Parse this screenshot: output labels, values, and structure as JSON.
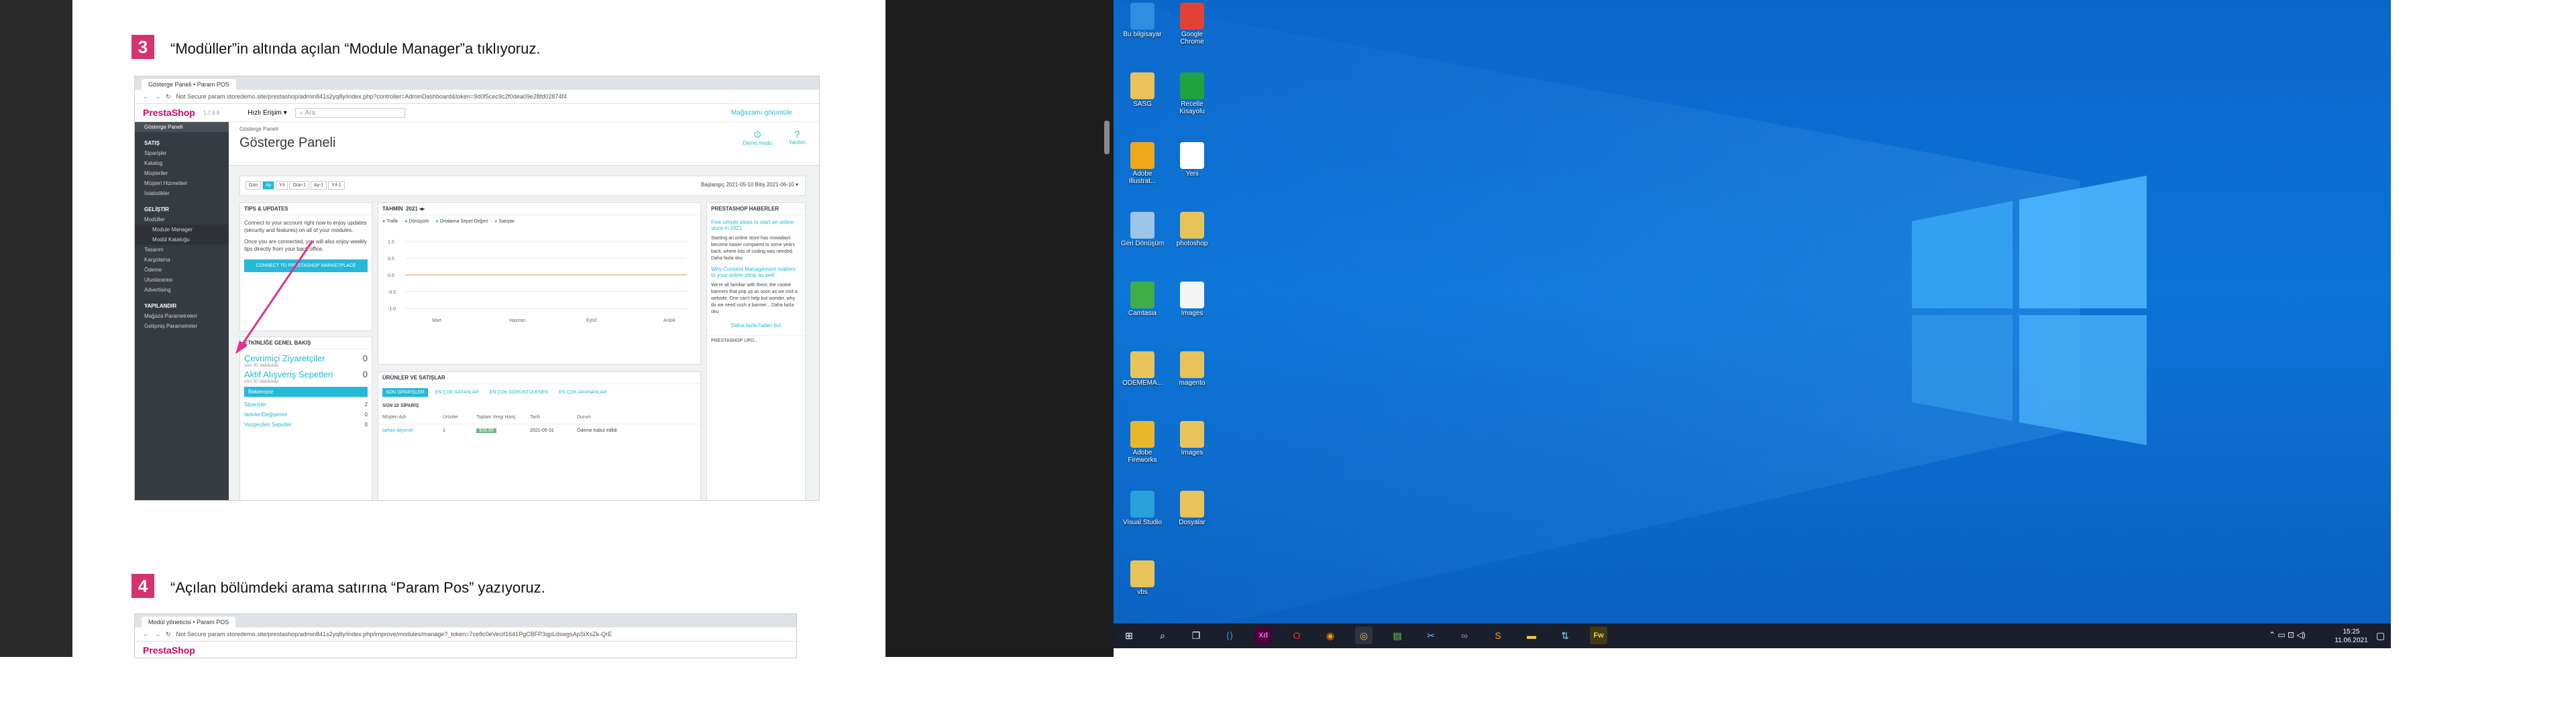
{
  "document": {
    "step3": {
      "number": "3",
      "text": "“Modüller”in altında açılan “Module Manager”a tıklıyoruz."
    },
    "step4": {
      "number": "4",
      "text": "“Açılan bölümdeki arama satırına “Param Pos” yazıyoruz."
    }
  },
  "screenshot1": {
    "tab": "Gösterge Paneli • Param POS",
    "url": "Not Secure   param.storedemo.site/prestashop/admin841s2yq8y/index.php?controller=AdminDashboard&token=9d0f5cec9c2f0dea09e28fd02874f4",
    "logo": "PrestaShop",
    "version": "1.7.6.8",
    "quick": "Hızlı Erişim ▾",
    "search": "Ara",
    "shop_link": "Mağazamı görüntüle",
    "breadcrumb": "Gösterge Paneli",
    "title": "Gösterge Paneli",
    "demo": "Demo modu",
    "help": "Yardım",
    "sidebar": [
      {
        "label": "Gösterge Paneli",
        "type": "item"
      },
      {
        "label": "SATIŞ",
        "type": "sec"
      },
      {
        "label": "Siparişler",
        "type": "item"
      },
      {
        "label": "Katalog",
        "type": "item"
      },
      {
        "label": "Müşteriler",
        "type": "item"
      },
      {
        "label": "Müşteri Hizmetleri",
        "type": "item"
      },
      {
        "label": "İstatistikler",
        "type": "item"
      },
      {
        "label": "GELİŞTİR",
        "type": "sec"
      },
      {
        "label": "Modüller",
        "type": "item"
      },
      {
        "label": "Module Manager",
        "type": "sub"
      },
      {
        "label": "Modül Kataloğu",
        "type": "sub"
      },
      {
        "label": "Tasarım",
        "type": "item"
      },
      {
        "label": "Kargolama",
        "type": "item"
      },
      {
        "label": "Ödeme",
        "type": "item"
      },
      {
        "label": "Uluslararası",
        "type": "item"
      },
      {
        "label": "Advertising",
        "type": "item"
      },
      {
        "label": "YAPILANDIR",
        "type": "sec"
      },
      {
        "label": "Mağaza Parametreleri",
        "type": "item"
      },
      {
        "label": "Gelişmiş Parametreler",
        "type": "item"
      }
    ],
    "range_buttons": [
      "Gün",
      "Ay",
      "Yıl",
      "Gün-1",
      "Ay-1",
      "Yıl-1"
    ],
    "date_range": "Başlangıç 2021-05-10 Bitiş 2021-06-10 ▾",
    "tips_title": "TIPS & UPDATES",
    "tips_text": "Connect to your account right now to enjoy updates (security and features) on all of your modules.",
    "tips_text2": "Once you are connected, you will also enjoy weekly tips directly from your back office.",
    "connect_btn": "CONNECT TO PRESTASHOP MARKETPLACE",
    "activity_title": "ETKİNLİĞE GENEL BAKIŞ",
    "online_visitors": "Çevrimiçi Ziyaretçiler",
    "online_visitors_value": "0",
    "active_carts": "Aktif Alışveriş Sepetleri",
    "active_carts_value": "0",
    "last30": "son 30 dakikada",
    "pending": "Bekleniyor",
    "orders": "Siparişler",
    "orders_value": "2",
    "returns": "İadeler/Değişimler",
    "returns_value": "0",
    "abandoned": "Vazgeçilen Sepetler",
    "abandoned_value": "0",
    "dash_title": "TAHMİN",
    "dash_year": "2021",
    "legend": [
      "Trafik",
      "Dönüşüm",
      "Ortalama Sepet Değeri",
      "Satışlar"
    ],
    "chart_y": [
      "1.0",
      "0.5",
      "0.0",
      "-0.5",
      "-1.0"
    ],
    "chart_x": [
      "Mart",
      "Haziran",
      "Eylül",
      "Aralık"
    ],
    "products_title": "ÜRÜNLER VE SATIŞLAR",
    "product_tabs": [
      "SON SİPARİŞLER",
      "EN ÇOK SATANLAR",
      "EN ÇOK GÖRÜNTÜLENEN",
      "EN ÇOK ARANANLAR"
    ],
    "last10": "SON 10 SİPARİŞ",
    "table_headers": [
      "Müşteri Adı",
      "Ürünler",
      "Toplam Vergi Hariç",
      "Tarih",
      "Durum"
    ],
    "table_row": [
      "tarkan akyener",
      "1",
      "$38.99",
      "2021-05-31",
      "Ödeme kabul edildi"
    ],
    "news_title": "PRESTASHOP HABERLER",
    "news1": "Five simple steps to start an online store in 2021",
    "news_body": "Starting an online store has nowadays become easier compared to some years back, where lots of coding was needed. Daha fazla oku",
    "news2": "Why Consent Management matters to your online shop as well",
    "news_body2": "We're all familiar with them: the cookie banners that pop up as soon as we visit a website. One can't help but wonder, why do we need such a banner... Daha fazla oku",
    "news_more": "Daha fazla haber bul",
    "news_footer": "PRESTASHOP UPD..."
  },
  "screenshot2": {
    "tab": "Modül yöneticisi • Param POS",
    "url": "Not Secure   param.storedemo.site/prestashop/admin841s2yq8y/index.php/improve/modules/manage?_token=7ce8c0eVecif1641PgCBFP3qpLdswgsApSiXsZk-QrE",
    "logo": "PrestaShop"
  },
  "desktop": {
    "icons": [
      {
        "label": "Bu bilgisayar",
        "color": "#2d8fe0"
      },
      {
        "label": "Google Chrome",
        "color": "#e34133"
      },
      {
        "label": "SASG",
        "color": "#e8c35a"
      },
      {
        "label": "Recelle Kisayolu",
        "color": "#1fa33f"
      },
      {
        "label": "Adobe Illustrat...",
        "color": "#f0a81a"
      },
      {
        "label": "Yeni",
        "color": "#ffffff"
      },
      {
        "label": "Geri Dönüşüm",
        "color": "#9ec4e8"
      },
      {
        "label": "photoshop",
        "color": "#e8c35a"
      },
      {
        "label": "Camtasia",
        "color": "#3fae49"
      },
      {
        "label": "Images",
        "color": "#f4f4f4"
      },
      {
        "label": "ODEMEMA...",
        "color": "#e8c35a"
      },
      {
        "label": "magento",
        "color": "#e8c35a"
      },
      {
        "label": "Adobe Fireworks",
        "color": "#e8b82a"
      },
      {
        "label": "Images",
        "color": "#e8c35a"
      },
      {
        "label": "Visual Studio",
        "color": "#2aa0d8"
      },
      {
        "label": "Dosyalar",
        "color": "#e8c35a"
      },
      {
        "label": "vbs",
        "color": "#e8c35a"
      }
    ],
    "clock_time": "15:25",
    "clock_date": "11.06.2021"
  }
}
